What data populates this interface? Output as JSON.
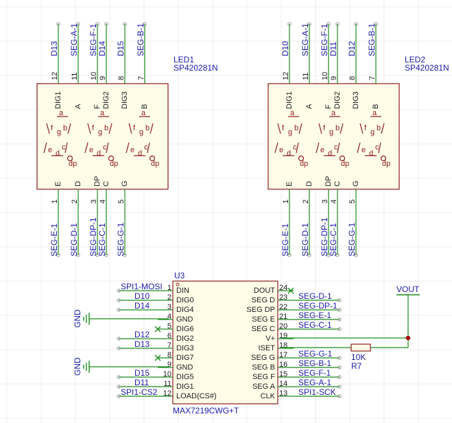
{
  "colors": {
    "wire": "#1a8a1a",
    "body": "#8b1a1a",
    "pin_text": "#1a1a1a",
    "net_label": "#1a1aaa",
    "junction": "#a00000",
    "noconnect": "#1a8a1a",
    "grid": "#ececec"
  },
  "led1": {
    "designator": "LED1",
    "part": "SP420281N",
    "top_pins": [
      {
        "num": "12",
        "name": "DIG1",
        "net": "D13"
      },
      {
        "num": "11",
        "name": "A",
        "net": "SEG-A-1"
      },
      {
        "num": "10",
        "name": "F",
        "net": "SEG-F-1"
      },
      {
        "num": "9",
        "name": "DIG2",
        "net": "D14"
      },
      {
        "num": "8",
        "name": "DIG3",
        "net": "D15"
      },
      {
        "num": "7",
        "name": "B",
        "net": "SEG-B-1"
      }
    ],
    "bottom_pins": [
      {
        "num": "1",
        "name": "E",
        "net": "SEG-E-1"
      },
      {
        "num": "2",
        "name": "D",
        "net": "SEG-D-1"
      },
      {
        "num": "3",
        "name": "DP",
        "net": "SEG-DP-1"
      },
      {
        "num": "4",
        "name": "C",
        "net": "SEG-C-1"
      },
      {
        "num": "5",
        "name": "G",
        "net": "SEG-G-1"
      }
    ]
  },
  "led2": {
    "designator": "LED2",
    "part": "SP420281N",
    "top_pins": [
      {
        "num": "12",
        "name": "DIG1",
        "net": "D10"
      },
      {
        "num": "11",
        "name": "A",
        "net": "SEG-A-1"
      },
      {
        "num": "10",
        "name": "F",
        "net": "SEG-F-1"
      },
      {
        "num": "9",
        "name": "DIG2",
        "net": "D11"
      },
      {
        "num": "8",
        "name": "DIG3",
        "net": "D12"
      },
      {
        "num": "7",
        "name": "B",
        "net": "SEG-B-1"
      }
    ],
    "bottom_pins": [
      {
        "num": "1",
        "name": "E",
        "net": "SEG-E-1"
      },
      {
        "num": "2",
        "name": "D",
        "net": "SEG-D-1"
      },
      {
        "num": "3",
        "name": "DP",
        "net": "SEG-DP-1"
      },
      {
        "num": "4",
        "name": "C",
        "net": "SEG-C-1"
      },
      {
        "num": "5",
        "name": "G",
        "net": "SEG-G-1"
      }
    ]
  },
  "segment_glyphs": {
    "a": "a",
    "b": "b",
    "c": "c",
    "d": "d",
    "e": "e",
    "f": "f",
    "g": "g",
    "dp": "dp"
  },
  "u3": {
    "designator": "U3",
    "part": "MAX7219CWG+T",
    "left_pins": [
      {
        "num": "1",
        "name": "DIN",
        "net": "SPI1-MOSI",
        "nc": false
      },
      {
        "num": "2",
        "name": "DIG0",
        "net": "D10",
        "nc": false
      },
      {
        "num": "3",
        "name": "DIG4",
        "net": "D14",
        "nc": false
      },
      {
        "num": "4",
        "name": "GND",
        "net": "GND",
        "nc": false
      },
      {
        "num": "5",
        "name": "DIG6",
        "net": "",
        "nc": true
      },
      {
        "num": "6",
        "name": "DIG2",
        "net": "D12",
        "nc": false
      },
      {
        "num": "7",
        "name": "DIG3",
        "net": "D13",
        "nc": false
      },
      {
        "num": "8",
        "name": "DIG7",
        "net": "",
        "nc": true
      },
      {
        "num": "9",
        "name": "GND",
        "net": "GND",
        "nc": false
      },
      {
        "num": "10",
        "name": "DIG5",
        "net": "D15",
        "nc": false
      },
      {
        "num": "11",
        "name": "DIG1",
        "net": "D11",
        "nc": false
      },
      {
        "num": "12",
        "name": "LOAD(CS#)",
        "net": "SPI1-CS2",
        "nc": false
      }
    ],
    "right_pins": [
      {
        "num": "24",
        "name": "DOUT",
        "net": "",
        "nc": true
      },
      {
        "num": "23",
        "name": "SEG D",
        "net": "SEG-D-1",
        "nc": false
      },
      {
        "num": "22",
        "name": "SEG DP",
        "net": "SEG-DP-1",
        "nc": false
      },
      {
        "num": "21",
        "name": "SEG E",
        "net": "SEG-E-1",
        "nc": false
      },
      {
        "num": "20",
        "name": "SEG C",
        "net": "SEG-C-1",
        "nc": false
      },
      {
        "num": "19",
        "name": "V+",
        "net": "",
        "nc": false
      },
      {
        "num": "18",
        "name": "ISET",
        "net": "",
        "nc": false
      },
      {
        "num": "17",
        "name": "SEG G",
        "net": "SEG-G-1",
        "nc": false
      },
      {
        "num": "16",
        "name": "SEG B",
        "net": "SEG-B-1",
        "nc": false
      },
      {
        "num": "15",
        "name": "SEG F",
        "net": "SEG-F-1",
        "nc": false
      },
      {
        "num": "14",
        "name": "SEG A",
        "net": "SEG-A-1",
        "nc": false
      },
      {
        "num": "13",
        "name": "CLK",
        "net": "SPI1-SCK",
        "nc": false
      }
    ]
  },
  "power": {
    "vout": "VOUT",
    "gnd": "GND"
  },
  "r7": {
    "designator": "R7",
    "value": "10K"
  }
}
